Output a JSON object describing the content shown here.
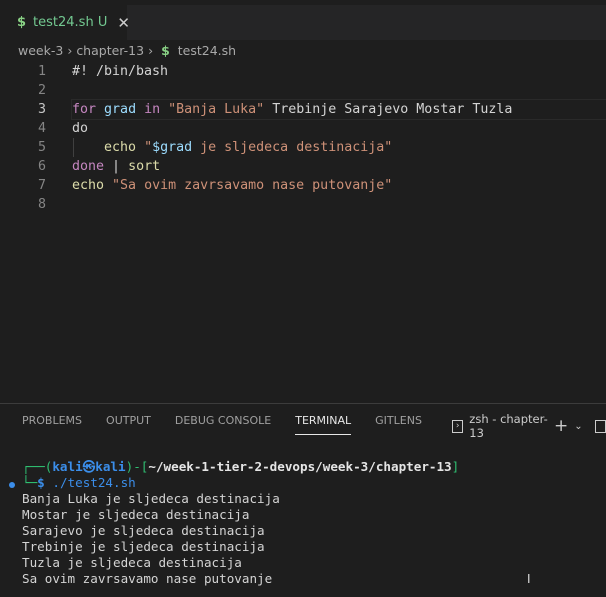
{
  "tab": {
    "icon": "$",
    "name": "test24.sh",
    "status": "U",
    "close": "✕"
  },
  "breadcrumb": [
    "week-3",
    "chapter-13",
    "test24.sh"
  ],
  "code": {
    "l1": "#! /bin/bash",
    "l3": {
      "for": "for",
      "grad": "grad",
      "in": "in",
      "str": "\"Banja Luka\"",
      "rest": " Trebinje Sarajevo Mostar Tuzla"
    },
    "l4": "do",
    "l5": {
      "echo": "echo",
      "q1": "\"",
      "var": "$grad",
      "str": " je sljedeca destinacija\""
    },
    "l6": {
      "done": "done",
      "rest": " | ",
      "sort": "sort"
    },
    "l7": {
      "echo": "echo",
      "str": "\"Sa ovim zavrsavamo nase putovanje\""
    }
  },
  "line_numbers": [
    "1",
    "2",
    "3",
    "4",
    "5",
    "6",
    "7",
    "8"
  ],
  "panel": {
    "tabs": [
      "PROBLEMS",
      "OUTPUT",
      "DEBUG CONSOLE",
      "TERMINAL",
      "GITLENS"
    ],
    "active": "TERMINAL",
    "terminal_name": "zsh - chapter-13"
  },
  "terminal": {
    "user": "kali㉿kali",
    "path": "~/week-1-tier-2-devops/week-3/chapter-13",
    "command": "./test24.sh",
    "output": [
      "Banja Luka je sljedeca destinacija",
      "Mostar je sljedeca destinacija",
      "Sarajevo je sljedeca destinacija",
      "Trebinje je sljedeca destinacija",
      "Tuzla je sljedeca destinacija",
      "Sa ovim zavrsavamo nase putovanje"
    ]
  }
}
